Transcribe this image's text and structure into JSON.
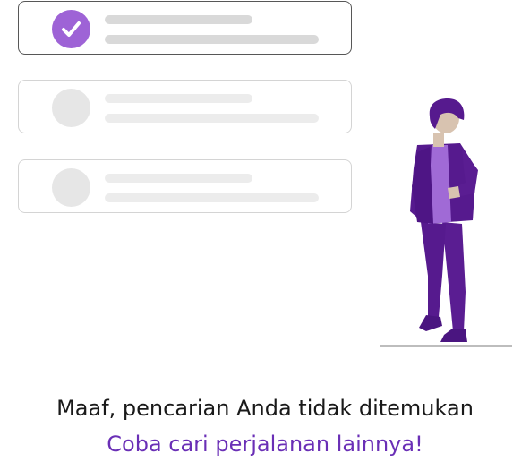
{
  "empty_state": {
    "title": "Maaf, pencarian Anda tidak ditemukan",
    "subtitle": "Coba cari perjalanan lainnya!"
  },
  "illustration": {
    "cards": [
      {
        "state": "selected",
        "icon": "check-icon"
      },
      {
        "state": "unselected"
      },
      {
        "state": "unselected"
      }
    ],
    "figure": "person-standing-illustration"
  },
  "colors": {
    "accent": "#9e63d6",
    "subtitle": "#6a2fb6",
    "figure_dark": "#561a8e",
    "figure_light": "#a06ad6"
  }
}
